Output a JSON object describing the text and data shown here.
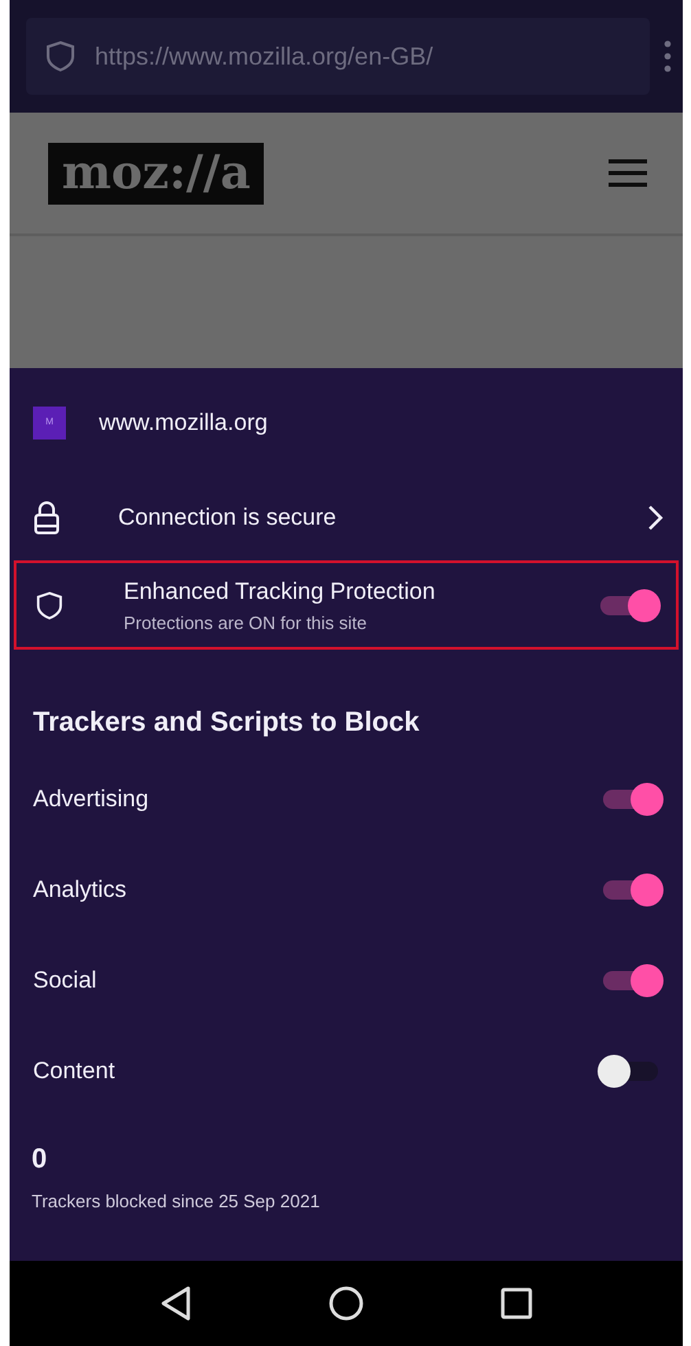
{
  "address_bar": {
    "url": "https://www.mozilla.org/en-GB/"
  },
  "page": {
    "logo": "moz://a"
  },
  "panel": {
    "site": "www.mozilla.org",
    "favicon": "M",
    "connection": {
      "label": "Connection is secure"
    },
    "tracking_protection": {
      "title": "Enhanced Tracking Protection",
      "subtitle": "Protections are ON for this site",
      "on": true,
      "highlighted": true
    },
    "section_title": "Trackers and Scripts to Block",
    "trackers": [
      {
        "label": "Advertising",
        "on": true
      },
      {
        "label": "Analytics",
        "on": true
      },
      {
        "label": "Social",
        "on": true
      },
      {
        "label": "Content",
        "on": false
      }
    ],
    "blocked_count": "0",
    "blocked_caption": "Trackers blocked since 25 Sep 2021"
  }
}
